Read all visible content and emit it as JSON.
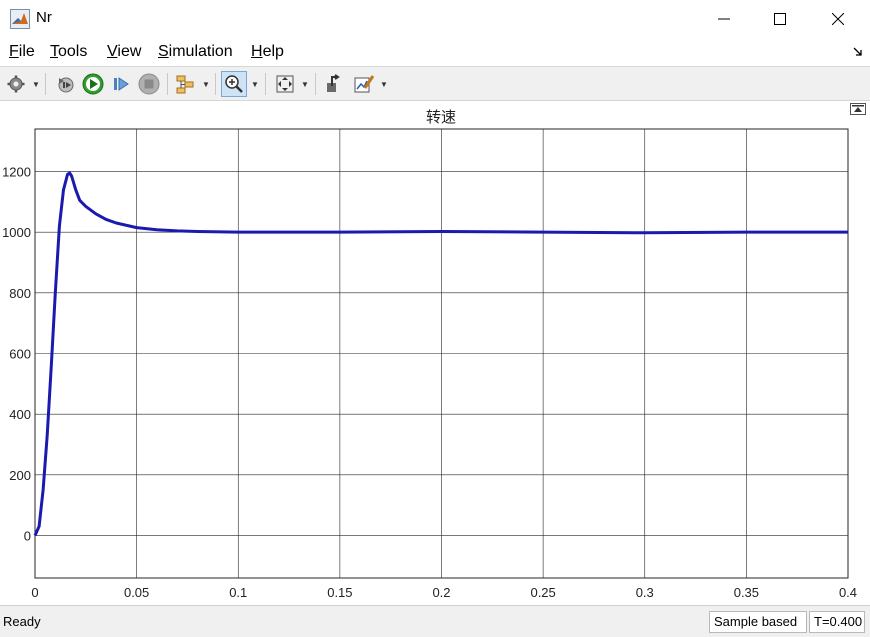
{
  "window": {
    "title": "Nr"
  },
  "menu": [
    {
      "label": "File",
      "mnemonic": "F",
      "rest": "ile"
    },
    {
      "label": "Tools",
      "mnemonic": "T",
      "rest": "ools"
    },
    {
      "label": "View",
      "mnemonic": "V",
      "rest": "iew"
    },
    {
      "label": "Simulation",
      "mnemonic": "S",
      "rest": "imulation"
    },
    {
      "label": "Help",
      "mnemonic": "H",
      "rest": "elp"
    }
  ],
  "toolbar": {
    "icons": [
      "gear-icon",
      "step-back-icon",
      "run-icon",
      "step-forward-icon",
      "stop-icon",
      "signal-select-icon",
      "zoom-in-icon",
      "fit-to-view-icon",
      "highlight-block-icon",
      "style-icon"
    ]
  },
  "colors": {
    "line": "#1a1aae",
    "grid": "#262626",
    "run_green": "#2e9e2e"
  },
  "chart_data": {
    "type": "line",
    "title": "转速",
    "xlabel": "",
    "ylabel": "",
    "xlim": [
      0,
      0.4
    ],
    "ylim": [
      -140,
      1340
    ],
    "grid": true,
    "x_ticks": [
      0,
      0.05,
      0.1,
      0.15,
      0.2,
      0.25,
      0.3,
      0.35,
      0.4
    ],
    "x_tick_labels": [
      "0",
      "0.05",
      "0.1",
      "0.15",
      "0.2",
      "0.25",
      "0.3",
      "0.35",
      "0.4"
    ],
    "y_ticks": [
      0,
      200,
      400,
      600,
      800,
      1000,
      1200
    ],
    "y_tick_labels": [
      "0",
      "200",
      "400",
      "600",
      "800",
      "1000",
      "1200"
    ],
    "series": [
      {
        "values": [
          [
            0,
            0
          ],
          [
            0.002,
            30
          ],
          [
            0.004,
            150
          ],
          [
            0.006,
            330
          ],
          [
            0.008,
            560
          ],
          [
            0.01,
            800
          ],
          [
            0.012,
            1020
          ],
          [
            0.014,
            1140
          ],
          [
            0.016,
            1190
          ],
          [
            0.017,
            1195
          ],
          [
            0.018,
            1185
          ],
          [
            0.02,
            1140
          ],
          [
            0.022,
            1105
          ],
          [
            0.025,
            1085
          ],
          [
            0.03,
            1060
          ],
          [
            0.035,
            1042
          ],
          [
            0.04,
            1030
          ],
          [
            0.05,
            1015
          ],
          [
            0.06,
            1008
          ],
          [
            0.07,
            1004
          ],
          [
            0.08,
            1002
          ],
          [
            0.1,
            1000
          ],
          [
            0.15,
            1000
          ],
          [
            0.2,
            1002
          ],
          [
            0.25,
            1000
          ],
          [
            0.3,
            998
          ],
          [
            0.35,
            1000
          ],
          [
            0.4,
            1000
          ]
        ]
      }
    ]
  },
  "status": {
    "ready": "Ready",
    "sample": "Sample based",
    "time": "T=0.400"
  }
}
